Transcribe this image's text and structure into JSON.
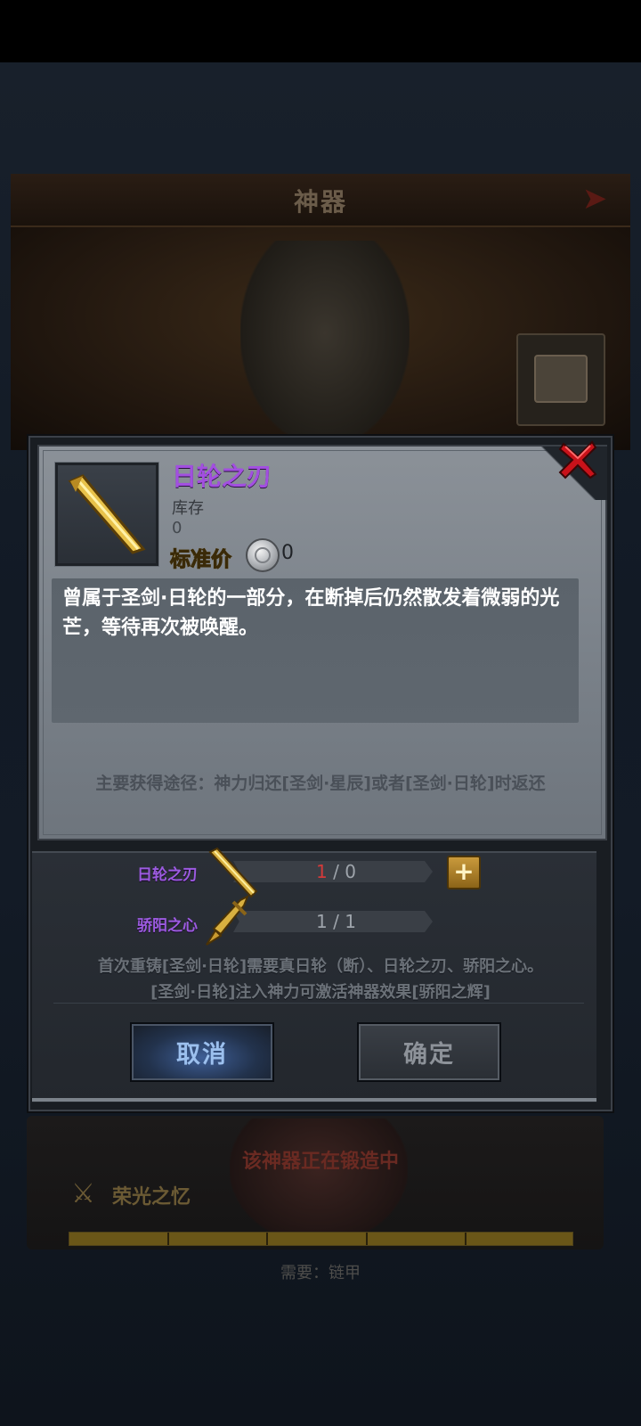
{
  "background": {
    "title": "神器",
    "status_text": "该神器正在锻造中",
    "glory_label": "荣光之忆",
    "require_text": "需要：链甲",
    "progress_segments": 5
  },
  "dialog": {
    "item_name": "日轮之刃",
    "stock_label": "库存",
    "stock_value": "0",
    "price_label": "标准价",
    "price_value": "0",
    "description": "曾属于圣剑·日轮的一部分，在断掉后仍然散发着微弱的光芒，等待再次被唤醒。",
    "source": "主要获得途径：神力归还[圣剑·星辰]或者[圣剑·日轮]时返还"
  },
  "materials": [
    {
      "name": "日轮之刃",
      "have": "1",
      "need": "0"
    },
    {
      "name": "骄阳之心",
      "have": "1",
      "need": "1"
    }
  ],
  "forge_note_1": "首次重铸[圣剑·日轮]需要真日轮（断）、日轮之刃、骄阳之心。",
  "forge_note_2": "[圣剑·日轮]注入神力可激活神器效果[骄阳之辉]",
  "buttons": {
    "cancel": "取消",
    "ok": "确定",
    "plus": "+"
  },
  "icons": {
    "close": "close-x-icon",
    "coin": "silver-coin-icon",
    "item": "golden-blade-fragment-icon",
    "material_1": "sword-blade-icon",
    "material_2": "sword-hilt-icon"
  },
  "colors": {
    "item_name": "#a24fe0",
    "material_name": "#9c5be0",
    "count_red": "#d23a3a",
    "cancel_button": "#3e5e96"
  }
}
